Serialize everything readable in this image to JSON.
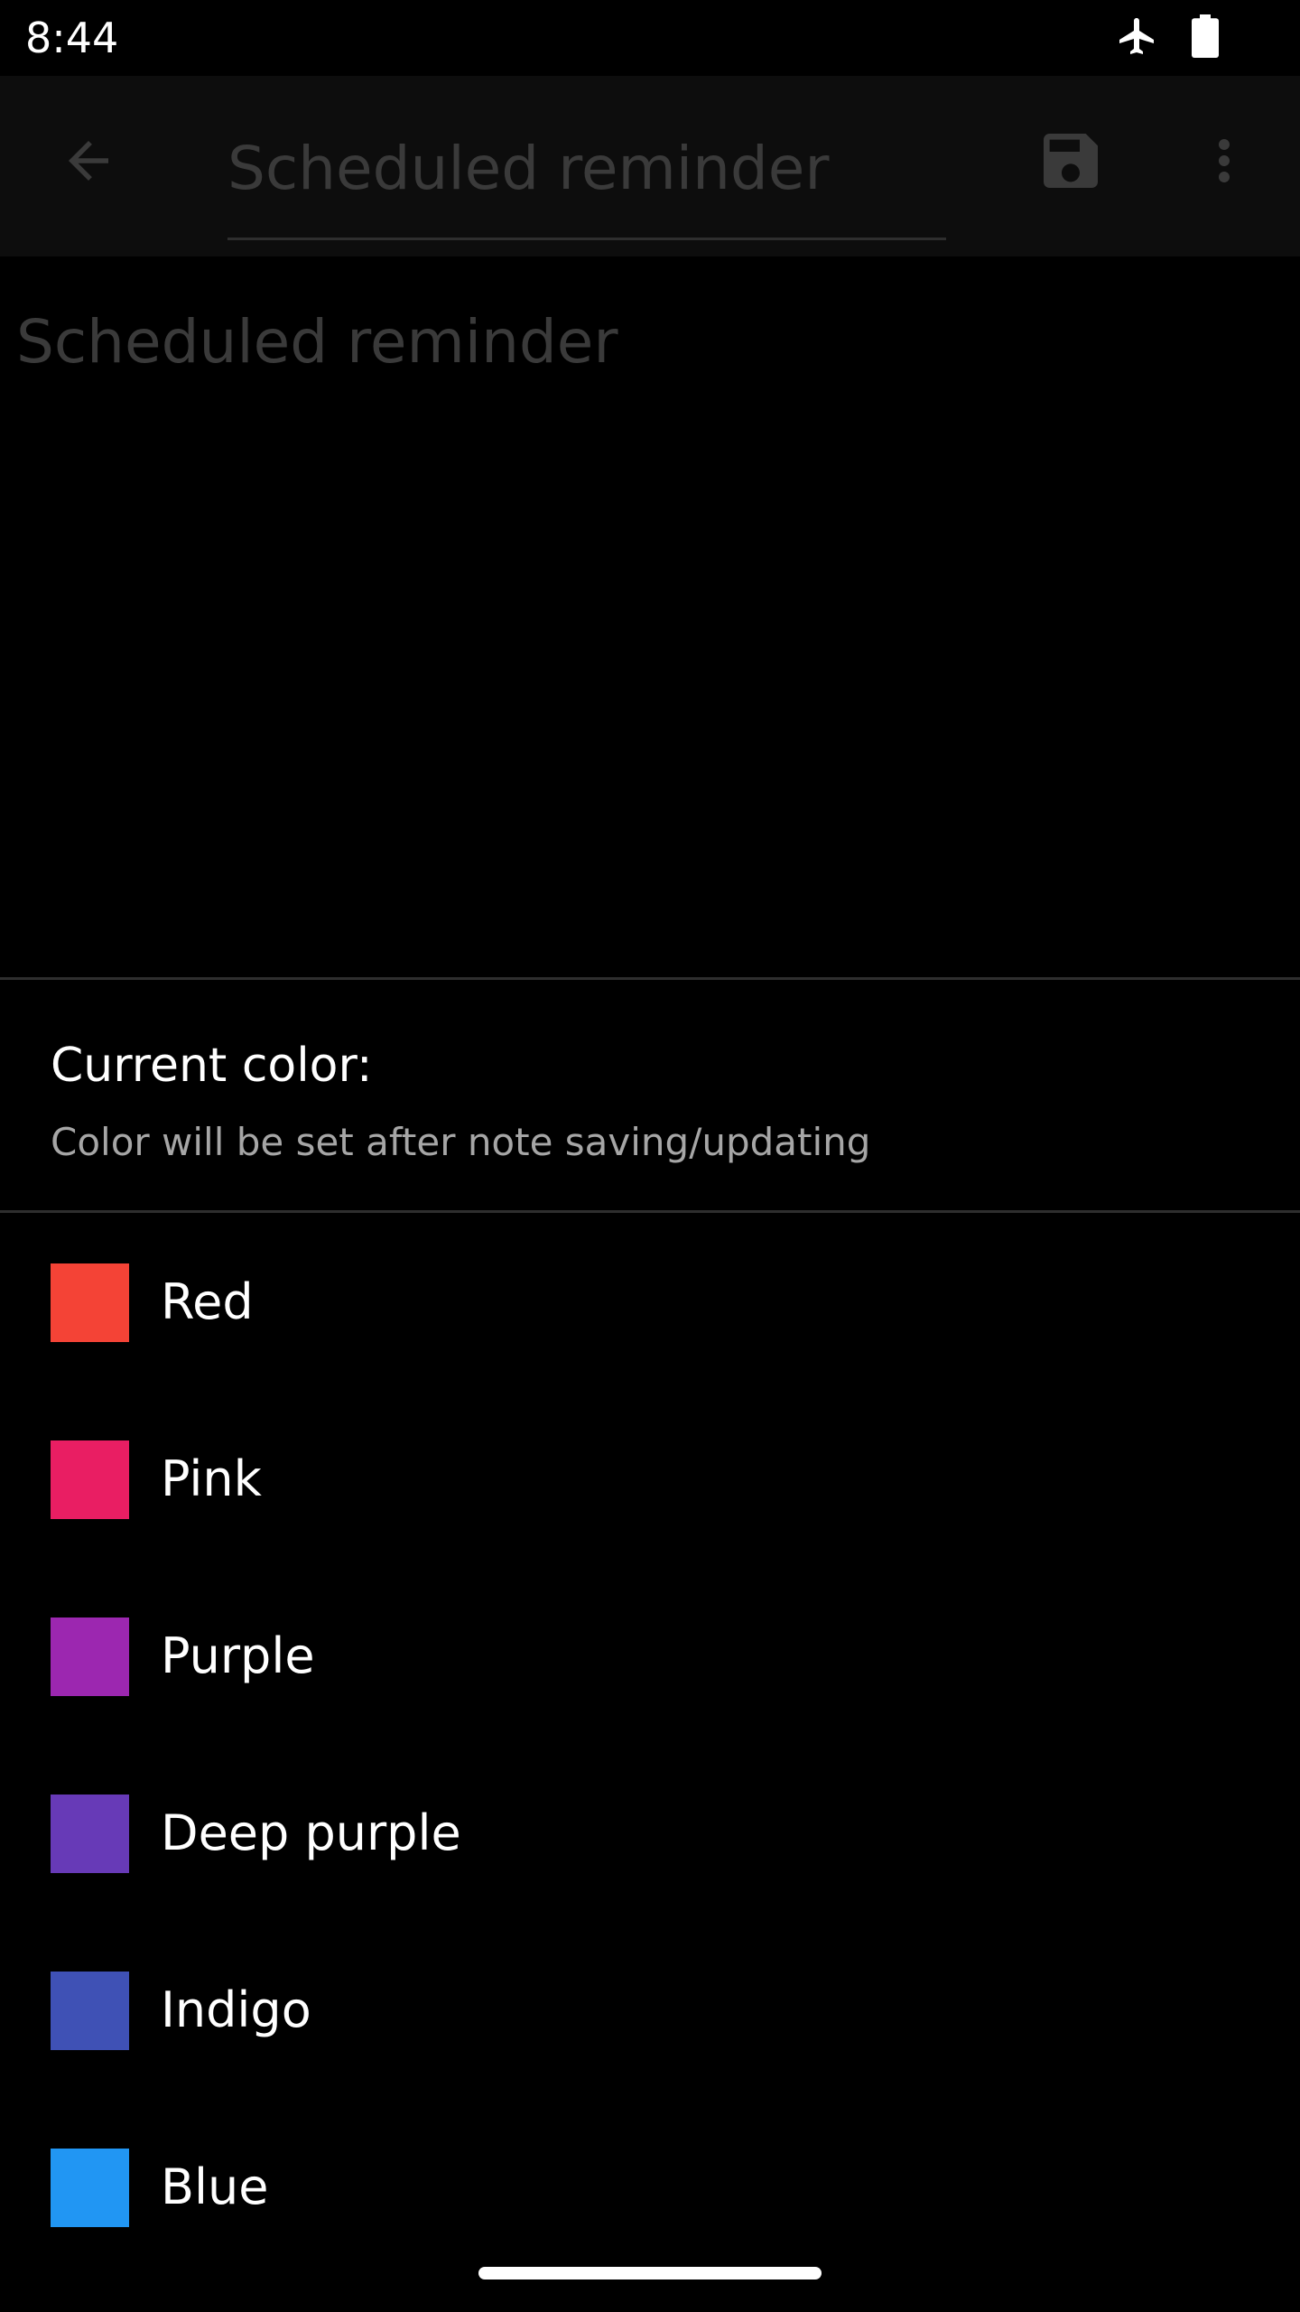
{
  "status_bar": {
    "time": "8:44",
    "icons": [
      "airplane-icon",
      "battery-icon"
    ]
  },
  "toolbar": {
    "back_icon": "arrow-back-icon",
    "title": "Scheduled reminder",
    "save_icon": "save-icon",
    "more_icon": "more-vert-icon"
  },
  "note": {
    "body": "Scheduled reminder"
  },
  "color_sheet": {
    "title": "Current color:",
    "subtitle": "Color will be set after note saving/updating",
    "colors": [
      {
        "label": "Red",
        "hex": "#F44336"
      },
      {
        "label": "Pink",
        "hex": "#E91E63"
      },
      {
        "label": "Purple",
        "hex": "#9C27B0"
      },
      {
        "label": "Deep purple",
        "hex": "#673AB7"
      },
      {
        "label": "Indigo",
        "hex": "#3F51B5"
      },
      {
        "label": "Blue",
        "hex": "#2196F3"
      }
    ]
  },
  "theme": {
    "background": "#000000",
    "divider": "#2e2e2e",
    "dimmed_text": "#3a3a3a",
    "secondary_text": "#a6a6a6"
  }
}
